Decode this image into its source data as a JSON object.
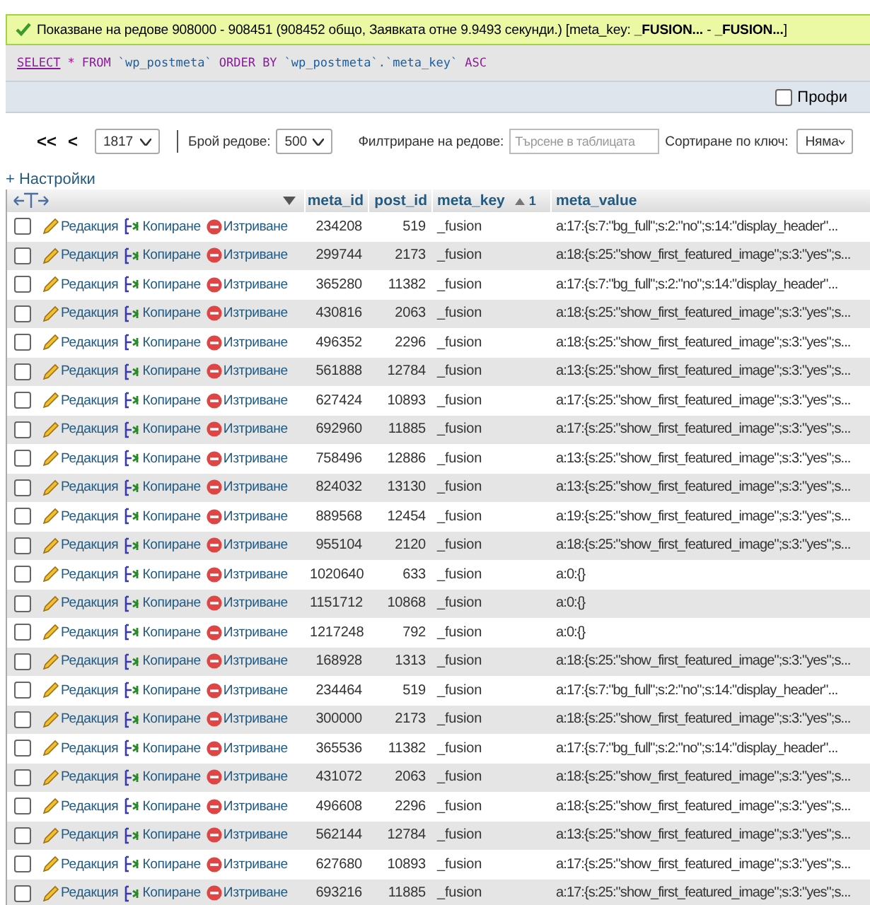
{
  "message": {
    "text": "Показване на редове 908000 - 908451 (908452 общо, Заявката отне 9.9493 секунди.) [meta_key: **_FUSION...** - **_FUSION...**]"
  },
  "sql": [
    {
      "kind": "link",
      "text": "SELECT"
    },
    {
      "kind": "operator",
      "text": "*"
    },
    {
      "kind": "keyword",
      "text": "FROM"
    },
    {
      "kind": "identifier",
      "text": "`wp_postmeta`"
    },
    {
      "kind": "keyword",
      "text": "ORDER BY"
    },
    {
      "kind": "identifier",
      "text": "`wp_postmeta`.`meta_key`"
    },
    {
      "kind": "keyword",
      "text": "ASC"
    }
  ],
  "profiling": {
    "label": "Профи",
    "checked": false
  },
  "navigation": {
    "first": "<<",
    "prev": "<",
    "page": "1817",
    "rows_label": "Брой редове:",
    "rows": "500",
    "filter_label": "Филтриране на редове:",
    "filter_placeholder": "Търсене в таблицата",
    "sort_label": "Сортиране по ключ:",
    "sort": "Няма"
  },
  "settings_link": "+ Настройки",
  "table": {
    "columns": [
      {
        "label": "meta_id"
      },
      {
        "label": "post_id"
      },
      {
        "label": "meta_key",
        "sort_ascending": true,
        "sort_index": "1"
      },
      {
        "label": "meta_value"
      }
    ],
    "rows": [
      {
        "checked": false,
        "edit": "Редакция",
        "copy": "Копиране",
        "delete": "Изтриване",
        "cells": [
          "234208",
          "519",
          "_fusion",
          "a:17:{s:7:\"bg_full\";s:2:\"no\";s:14:\"display_header\"..."
        ]
      },
      {
        "checked": false,
        "edit": "Редакция",
        "copy": "Копиране",
        "delete": "Изтриване",
        "cells": [
          "299744",
          "2173",
          "_fusion",
          "a:18:{s:25:\"show_first_featured_image\";s:3:\"yes\";s..."
        ]
      },
      {
        "checked": false,
        "edit": "Редакция",
        "copy": "Копиране",
        "delete": "Изтриване",
        "cells": [
          "365280",
          "11382",
          "_fusion",
          "a:17:{s:7:\"bg_full\";s:2:\"no\";s:14:\"display_header\"..."
        ]
      },
      {
        "checked": false,
        "edit": "Редакция",
        "copy": "Копиране",
        "delete": "Изтриване",
        "cells": [
          "430816",
          "2063",
          "_fusion",
          "a:18:{s:25:\"show_first_featured_image\";s:3:\"yes\";s..."
        ]
      },
      {
        "checked": false,
        "edit": "Редакция",
        "copy": "Копиране",
        "delete": "Изтриване",
        "cells": [
          "496352",
          "2296",
          "_fusion",
          "a:18:{s:25:\"show_first_featured_image\";s:3:\"yes\";s..."
        ]
      },
      {
        "checked": false,
        "edit": "Редакция",
        "copy": "Копиране",
        "delete": "Изтриване",
        "cells": [
          "561888",
          "12784",
          "_fusion",
          "a:13:{s:25:\"show_first_featured_image\";s:3:\"yes\";s..."
        ]
      },
      {
        "checked": false,
        "edit": "Редакция",
        "copy": "Копиране",
        "delete": "Изтриване",
        "cells": [
          "627424",
          "10893",
          "_fusion",
          "a:17:{s:25:\"show_first_featured_image\";s:3:\"yes\";s..."
        ]
      },
      {
        "checked": false,
        "edit": "Редакция",
        "copy": "Копиране",
        "delete": "Изтриване",
        "cells": [
          "692960",
          "11885",
          "_fusion",
          "a:17:{s:25:\"show_first_featured_image\";s:3:\"yes\";s..."
        ]
      },
      {
        "checked": false,
        "edit": "Редакция",
        "copy": "Копиране",
        "delete": "Изтриване",
        "cells": [
          "758496",
          "12886",
          "_fusion",
          "a:13:{s:25:\"show_first_featured_image\";s:3:\"yes\";s..."
        ]
      },
      {
        "checked": false,
        "edit": "Редакция",
        "copy": "Копиране",
        "delete": "Изтриване",
        "cells": [
          "824032",
          "13130",
          "_fusion",
          "a:13:{s:25:\"show_first_featured_image\";s:3:\"yes\";s..."
        ]
      },
      {
        "checked": false,
        "edit": "Редакция",
        "copy": "Копиране",
        "delete": "Изтриване",
        "cells": [
          "889568",
          "12454",
          "_fusion",
          "a:19:{s:25:\"show_first_featured_image\";s:3:\"yes\";s..."
        ]
      },
      {
        "checked": false,
        "edit": "Редакция",
        "copy": "Копиране",
        "delete": "Изтриване",
        "cells": [
          "955104",
          "2120",
          "_fusion",
          "a:18:{s:25:\"show_first_featured_image\";s:3:\"yes\";s..."
        ]
      },
      {
        "checked": false,
        "edit": "Редакция",
        "copy": "Копиране",
        "delete": "Изтриване",
        "cells": [
          "1020640",
          "633",
          "_fusion",
          "a:0:{}"
        ]
      },
      {
        "checked": false,
        "edit": "Редакция",
        "copy": "Копиране",
        "delete": "Изтриване",
        "cells": [
          "1151712",
          "10868",
          "_fusion",
          "a:0:{}"
        ]
      },
      {
        "checked": false,
        "edit": "Редакция",
        "copy": "Копиране",
        "delete": "Изтриване",
        "cells": [
          "1217248",
          "792",
          "_fusion",
          "a:0:{}"
        ]
      },
      {
        "checked": false,
        "edit": "Редакция",
        "copy": "Копиране",
        "delete": "Изтриване",
        "cells": [
          "168928",
          "1313",
          "_fusion",
          "a:18:{s:25:\"show_first_featured_image\";s:3:\"yes\";s..."
        ]
      },
      {
        "checked": false,
        "edit": "Редакция",
        "copy": "Копиране",
        "delete": "Изтриване",
        "cells": [
          "234464",
          "519",
          "_fusion",
          "a:17:{s:7:\"bg_full\";s:2:\"no\";s:14:\"display_header\"..."
        ]
      },
      {
        "checked": false,
        "edit": "Редакция",
        "copy": "Копиране",
        "delete": "Изтриване",
        "cells": [
          "300000",
          "2173",
          "_fusion",
          "a:18:{s:25:\"show_first_featured_image\";s:3:\"yes\";s..."
        ]
      },
      {
        "checked": false,
        "edit": "Редакция",
        "copy": "Копиране",
        "delete": "Изтриване",
        "cells": [
          "365536",
          "11382",
          "_fusion",
          "a:17:{s:7:\"bg_full\";s:2:\"no\";s:14:\"display_header\"..."
        ]
      },
      {
        "checked": false,
        "edit": "Редакция",
        "copy": "Копиране",
        "delete": "Изтриване",
        "cells": [
          "431072",
          "2063",
          "_fusion",
          "a:18:{s:25:\"show_first_featured_image\";s:3:\"yes\";s..."
        ]
      },
      {
        "checked": false,
        "edit": "Редакция",
        "copy": "Копиране",
        "delete": "Изтриване",
        "cells": [
          "496608",
          "2296",
          "_fusion",
          "a:18:{s:25:\"show_first_featured_image\";s:3:\"yes\";s..."
        ]
      },
      {
        "checked": false,
        "edit": "Редакция",
        "copy": "Копиране",
        "delete": "Изтриване",
        "cells": [
          "562144",
          "12784",
          "_fusion",
          "a:13:{s:25:\"show_first_featured_image\";s:3:\"yes\";s..."
        ]
      },
      {
        "checked": false,
        "edit": "Редакция",
        "copy": "Копиране",
        "delete": "Изтриване",
        "cells": [
          "627680",
          "10893",
          "_fusion",
          "a:17:{s:25:\"show_first_featured_image\";s:3:\"yes\";s..."
        ]
      },
      {
        "checked": false,
        "edit": "Редакция",
        "copy": "Копиране",
        "delete": "Изтриване",
        "cells": [
          "693216",
          "11885",
          "_fusion",
          "a:17:{s:25:\"show_first_featured_image\";s:3:\"yes\";s..."
        ]
      }
    ]
  }
}
